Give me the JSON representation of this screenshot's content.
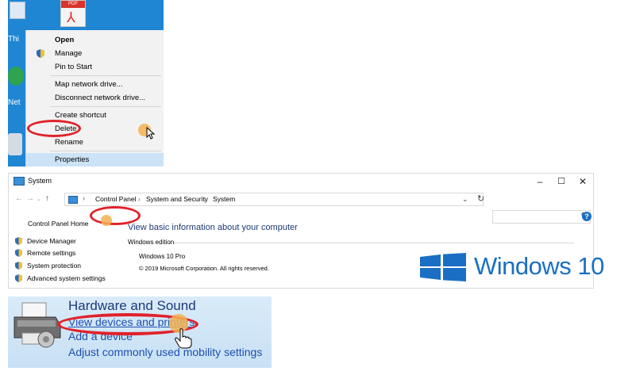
{
  "desktop": {
    "pdf_icon_label": "PDF",
    "side_fragment_1": "Thi",
    "side_fragment_2": "Net"
  },
  "context_menu": {
    "items": [
      {
        "label": "Open",
        "bold": true
      },
      {
        "label": "Manage",
        "icon": "uac-shield-icon"
      },
      {
        "label": "Pin to Start"
      },
      {
        "label": "Map network drive..."
      },
      {
        "label": "Disconnect network drive..."
      },
      {
        "label": "Create shortcut"
      },
      {
        "label": "Delete"
      },
      {
        "label": "Rename"
      },
      {
        "label": "Properties",
        "highlighted": true
      }
    ]
  },
  "system_window": {
    "title": "System",
    "controls": {
      "minimize": "–",
      "maximize": "☐",
      "close": "✕"
    },
    "breadcrumb": [
      "Control Panel",
      "System and Security",
      "System"
    ],
    "breadcrumb_separator": "›",
    "search_placeholder": "",
    "help": "?",
    "sidebar": {
      "home": "Control Panel Home",
      "links": [
        "Device Manager",
        "Remote settings",
        "System protection",
        "Advanced system settings"
      ]
    },
    "heading": "View basic information about your computer",
    "edition_section": "Windows edition",
    "edition_name": "Windows 10 Pro",
    "copyright": "© 2019 Microsoft Corporation. All rights reserved.",
    "logo_text": "Windows 10",
    "accent": "#1a6fc4"
  },
  "hardware_sound": {
    "title": "Hardware and Sound",
    "links": [
      "View devices and printers",
      "Add a device",
      "Adjust commonly used mobility settings"
    ]
  },
  "annotation_color": "#e0222a"
}
